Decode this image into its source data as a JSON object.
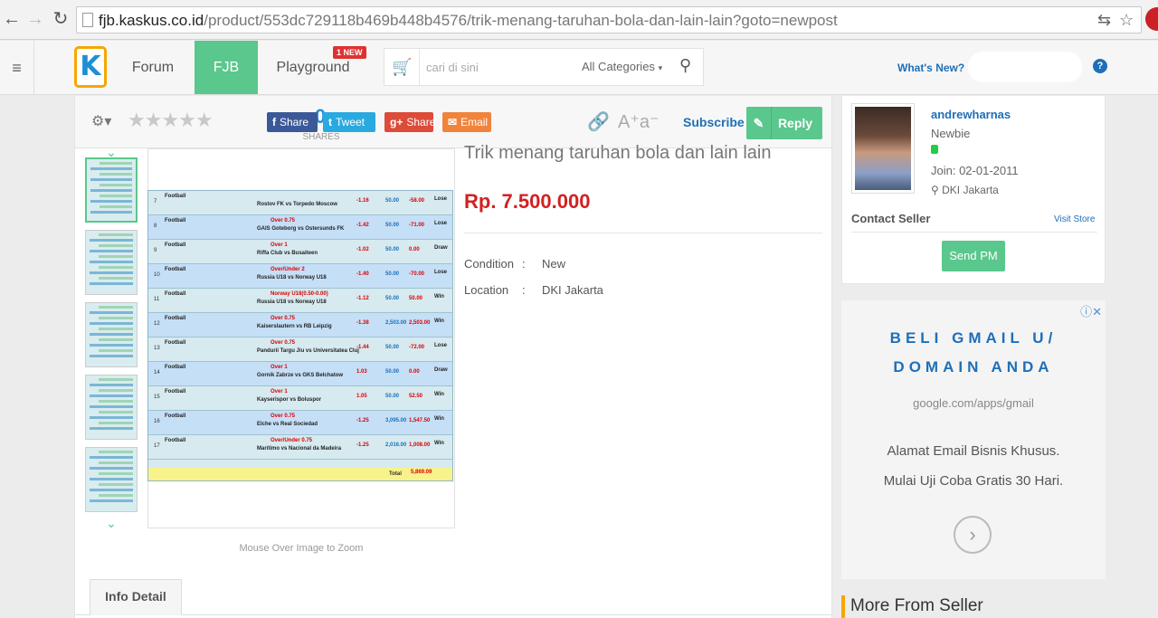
{
  "browser": {
    "url_host": "fjb.kaskus.co.id",
    "url_path": "/product/553dc729118b469b448b4576/trik-menang-taruhan-bola-dan-lain-lain?goto=newpost"
  },
  "header": {
    "menu_icon": "≡",
    "logo_text": "K",
    "tabs": [
      {
        "label": "Forum"
      },
      {
        "label": "FJB"
      },
      {
        "label": "Playground",
        "badge": "1 NEW"
      }
    ],
    "search": {
      "placeholder": "cari di sini",
      "category": "All Categories"
    },
    "whats_new": "What's New?",
    "help": "?"
  },
  "toolbar": {
    "shares_count": "0",
    "shares_label": "SHARES",
    "share_buttons": [
      {
        "icon": "f",
        "label": "Share",
        "color": "#3b5998"
      },
      {
        "icon": "t",
        "label": "Tweet",
        "color": "#2aa9e0"
      },
      {
        "icon": "g+",
        "label": "Share",
        "color": "#dd4b39"
      },
      {
        "icon": "✉",
        "label": "Email",
        "color": "#f0843c"
      }
    ],
    "subscribe": "Subscribe",
    "reply": "Reply"
  },
  "product": {
    "title": "Trik menang taruhan bola dan lain lain",
    "price": "Rp. 7.500.000",
    "attributes": [
      {
        "key": "Condition",
        "value": "New"
      },
      {
        "key": "Location",
        "value": "DKI Jakarta"
      }
    ],
    "zoom_hint": "Mouse Over Image to Zoom"
  },
  "bet_image": {
    "rows": [
      {
        "num": "7",
        "label": "Football",
        "red": "",
        "match": "Rostov FK vs Torpedo Moscow",
        "odd": "-1.16",
        "stake": "50.00",
        "win": "-58.00",
        "res": "Lose"
      },
      {
        "num": "8",
        "label": "Football",
        "red": "Over 0.75",
        "match": "GAIS Goteborg vs Ostersunds FK",
        "odd": "-1.42",
        "stake": "50.00",
        "win": "-71.00",
        "res": "Lose"
      },
      {
        "num": "9",
        "label": "Football",
        "red": "Over 1",
        "match": "Riffa Club vs Busaiteen",
        "odd": "-1.02",
        "stake": "50.00",
        "win": "0.00",
        "res": "Draw"
      },
      {
        "num": "10",
        "label": "Football",
        "red": "Over/Under 2",
        "match": "Russia U18 vs Norway U18",
        "odd": "-1.40",
        "stake": "50.00",
        "win": "-70.00",
        "res": "Lose"
      },
      {
        "num": "11",
        "label": "Football",
        "red": "Norway U18(0.50-0.00)",
        "match": "Russia U18 vs Norway U18",
        "odd": "-1.12",
        "stake": "50.00",
        "win": "50.00",
        "res": "Win"
      },
      {
        "num": "12",
        "label": "Football",
        "red": "Over 0.75",
        "match": "Kaiserslautern vs RB Leipzig",
        "odd": "-1.38",
        "stake": "2,503.00",
        "win": "2,503.00",
        "res": "Win"
      },
      {
        "num": "13",
        "label": "Football",
        "red": "Over 0.75",
        "match": "Pandurii Targu Jiu vs Universitatea Cluj",
        "odd": "-1.44",
        "stake": "50.00",
        "win": "-72.00",
        "res": "Lose"
      },
      {
        "num": "14",
        "label": "Football",
        "red": "Over 1",
        "match": "Gornik Zabrze vs GKS Belchatow",
        "odd": "1.03",
        "stake": "50.00",
        "win": "0.00",
        "res": "Draw"
      },
      {
        "num": "15",
        "label": "Football",
        "red": "Over 1",
        "match": "Kayserispor vs Boluspor",
        "odd": "1.05",
        "stake": "50.00",
        "win": "52.50",
        "res": "Win"
      },
      {
        "num": "16",
        "label": "Football",
        "red": "Over 0.75",
        "match": "Elche vs Real Sociedad",
        "odd": "-1.25",
        "stake": "3,095.00",
        "win": "1,547.50",
        "res": "Win"
      },
      {
        "num": "17",
        "label": "Football",
        "red": "Over/Under 0.75",
        "match": "Marítimo vs Nacional da Madeira",
        "odd": "-1.25",
        "stake": "2,016.00",
        "win": "1,008.00",
        "res": "Win"
      }
    ],
    "total_label": "Total",
    "total_value": "5,869.09"
  },
  "tabs": {
    "info_detail": "Info Detail"
  },
  "seller": {
    "name": "andrewharnas",
    "rank": "Newbie",
    "join": "Join: 02-01-2011",
    "location": "DKI Jakarta",
    "contact_label": "Contact Seller",
    "visit_store": "Visit Store",
    "send_pm": "Send PM",
    "online_color": "#22cc44"
  },
  "ad": {
    "headline_1": "BELI GMAIL U/",
    "headline_2": "DOMAIN ANDA",
    "url": "google.com/apps/gmail",
    "body_1": "Alamat Email Bisnis Khusus.",
    "body_2": "Mulai Uji Coba Gratis 30 Hari."
  },
  "more_from": "More From Seller",
  "colors": {
    "accent_green": "#5ac78c",
    "link_blue": "#1e6fb8",
    "price_red": "#d42020",
    "logo_orange": "#f7a600"
  }
}
